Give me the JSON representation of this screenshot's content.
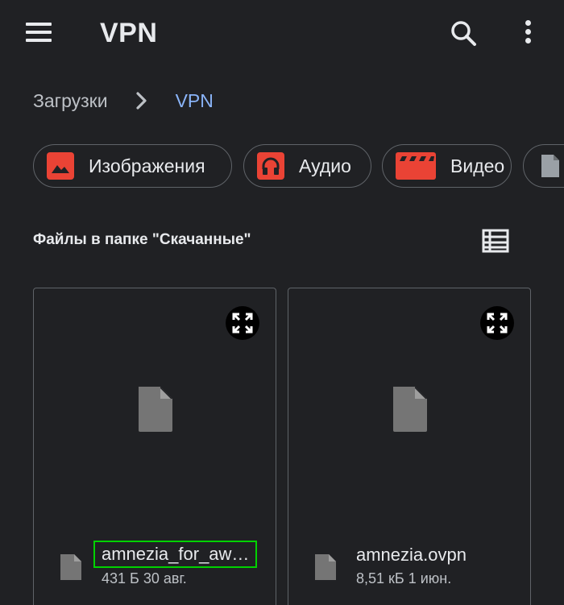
{
  "header": {
    "title": "VPN",
    "menu_icon": "hamburger-menu-icon",
    "search_icon": "search-icon",
    "more_icon": "more-vert-icon"
  },
  "breadcrumb": {
    "root": "Загрузки",
    "separator_icon": "chevron-right-icon",
    "current": "VPN"
  },
  "chips": [
    {
      "label": "Изображения",
      "icon": "image-icon",
      "color": "#ea4335"
    },
    {
      "label": "Аудио",
      "icon": "headphones-icon",
      "color": "#ea4335"
    },
    {
      "label": "Видео",
      "icon": "movie-icon",
      "color": "#ea4335"
    },
    {
      "label": "",
      "icon": "document-icon",
      "color": "#9aa0a6"
    }
  ],
  "section": {
    "title": "Файлы в папке \"Скачанные\"",
    "view_toggle_icon": "list-view-icon"
  },
  "files": [
    {
      "name": "amnezia_for_aw…",
      "meta": "431 Б 30 авг.",
      "icon": "file-icon",
      "highlighted": true
    },
    {
      "name": "amnezia.ovpn",
      "meta": "8,51 кБ 1 июн.",
      "icon": "file-icon",
      "highlighted": false
    }
  ],
  "colors": {
    "background": "#202124",
    "accent": "#8ab4f8",
    "chip_icon": "#ea4335",
    "highlight_border": "#00d200"
  }
}
